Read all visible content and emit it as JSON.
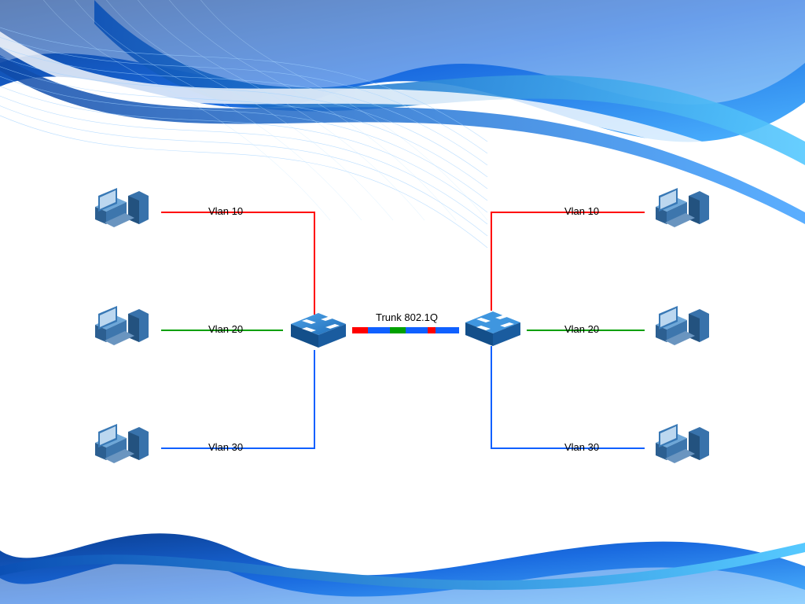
{
  "diagram": {
    "trunk_label": "Trunk 802.1Q",
    "vlans": {
      "left": [
        {
          "label": "Vlan 10",
          "color": "#ff0000"
        },
        {
          "label": "Vlan 20",
          "color": "#00a000"
        },
        {
          "label": "Vlan 30",
          "color": "#1060ff"
        }
      ],
      "right": [
        {
          "label": "Vlan 10",
          "color": "#ff0000"
        },
        {
          "label": "Vlan 20",
          "color": "#00a000"
        },
        {
          "label": "Vlan 30",
          "color": "#1060ff"
        }
      ]
    },
    "switches": 2,
    "pcs_per_side": 3
  }
}
